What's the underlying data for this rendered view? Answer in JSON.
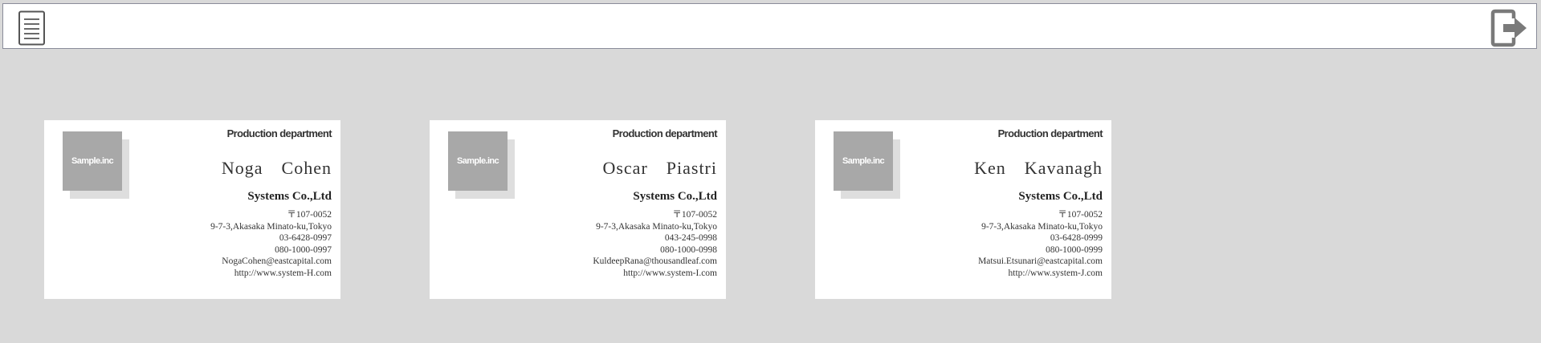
{
  "toolbar": {
    "menu_icon": "hamburger-menu-icon",
    "logout_icon": "logout-exit-icon"
  },
  "cards": [
    {
      "logo_text": "Sample.inc",
      "department": "Production department",
      "name": "Noga　Cohen",
      "company": "Systems Co.,Ltd",
      "postal": "〒107-0052",
      "address": "9-7-3,Akasaka Minato-ku,Tokyo",
      "phone": "03-6428-0997",
      "mobile": "080-1000-0997",
      "email": "NogaCohen@eastcapital.com",
      "url": "http://www.system-H.com"
    },
    {
      "logo_text": "Sample.inc",
      "department": "Production department",
      "name": "Oscar　Piastri",
      "company": "Systems Co.,Ltd",
      "postal": "〒107-0052",
      "address": "9-7-3,Akasaka Minato-ku,Tokyo",
      "phone": "043-245-0998",
      "mobile": "080-1000-0998",
      "email": "KuldeepRana@thousandleaf.com",
      "url": "http://www.system-I.com"
    },
    {
      "logo_text": "Sample.inc",
      "department": "Production department",
      "name": "Ken　Kavanagh",
      "company": "Systems Co.,Ltd",
      "postal": "〒107-0052",
      "address": "9-7-3,Akasaka Minato-ku,Tokyo",
      "phone": "03-6428-0999",
      "mobile": "080-1000-0999",
      "email": "Matsui.Etsunari@eastcapital.com",
      "url": "http://www.system-J.com"
    }
  ]
}
